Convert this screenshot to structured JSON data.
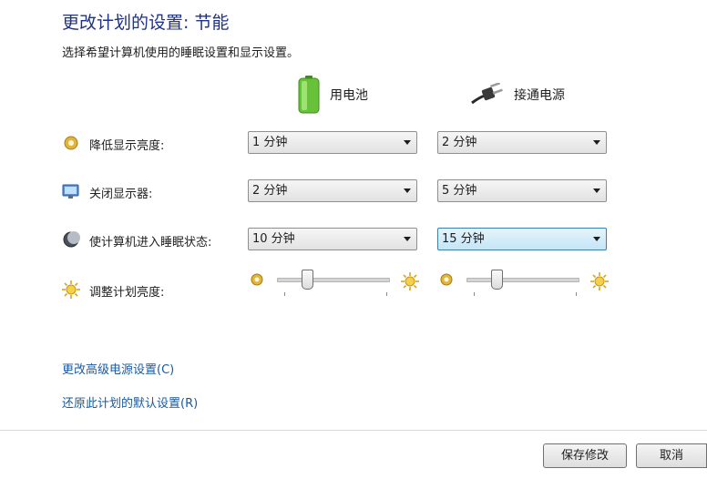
{
  "header": {
    "title": "更改计划的设置: 节能",
    "subtitle": "选择希望计算机使用的睡眠设置和显示设置。"
  },
  "columns": {
    "battery": {
      "label": "用电池",
      "icon": "battery-icon"
    },
    "plugged": {
      "label": "接通电源",
      "icon": "power-plug-icon"
    }
  },
  "rows": [
    {
      "label": "降低显示亮度:",
      "icon": "dim-display-icon",
      "battery": "1 分钟",
      "plugged": "2 分钟"
    },
    {
      "label": "关闭显示器:",
      "icon": "monitor-off-icon",
      "battery": "2 分钟",
      "plugged": "5 分钟"
    },
    {
      "label": "使计算机进入睡眠状态:",
      "icon": "sleep-moon-icon",
      "battery": "10 分钟",
      "plugged": "15 分钟"
    }
  ],
  "brightness": {
    "label": "调整计划亮度:",
    "icon": "brightness-icon",
    "battery_level": 0.27,
    "plugged_level": 0.27
  },
  "links": {
    "advanced": "更改高级电源设置(C)",
    "restore": "还原此计划的默认设置(R)"
  },
  "buttons": {
    "save": "保存修改",
    "cancel": "取消"
  },
  "colors": {
    "title": "#1e3287",
    "link": "#1a5aa0",
    "focus": "#3c7fb1"
  }
}
